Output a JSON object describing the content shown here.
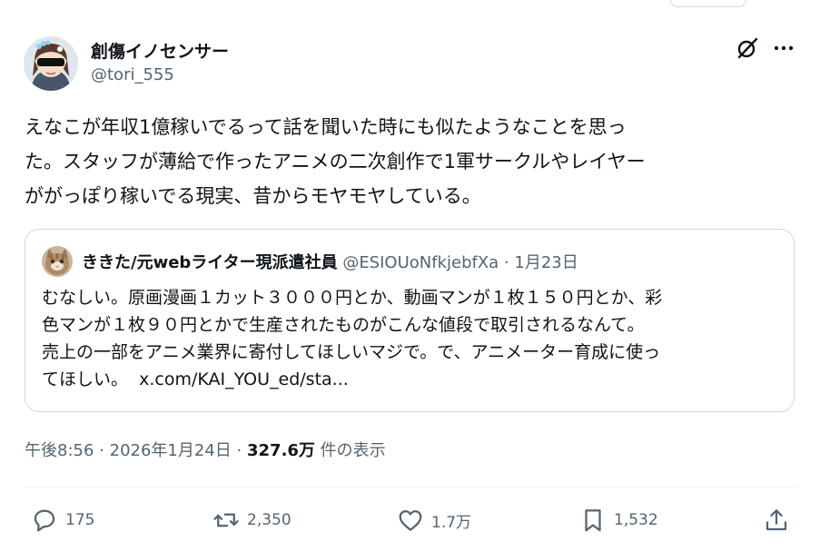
{
  "author": {
    "name": "創傷イノセンサー",
    "handle": "@tori_555"
  },
  "tweet": {
    "lines": [
      "えなこが年収1億稼いでるって話を聞いた時にも似たようなことを思っ",
      "た。スタッフが薄給で作ったアニメの二次創作で1軍サークルやレイヤー",
      "ががっぽり稼いでる現実、昔からモヤモヤしている。"
    ]
  },
  "quote": {
    "name": "ききた/元webライター現派遣社員",
    "handle": "@ESIOUoNfkjebfXa",
    "separator": "·",
    "date": "1月23日",
    "lines": [
      "むなしい。原画漫画１カット３０００円とか、動画マンが１枚１５０円とか、彩",
      "色マンが１枚９０円とかで生産されたものがこんな値段で取引されるなんて。",
      "売上の一部をアニメ業界に寄付してほしいマジで。で、アニメーター育成に使っ",
      "てほしい。"
    ],
    "link": "x.com/KAI_YOU_ed/sta..."
  },
  "meta": {
    "time": "午後8:56",
    "sep1": "·",
    "date": "2026年1月24日",
    "sep2": "·",
    "views": "327.6万",
    "views_label": "件の表示"
  },
  "actions": {
    "replies": "175",
    "reposts": "2,350",
    "likes": "1.7万",
    "bookmarks": "1,532"
  },
  "icons": {
    "reply": "reply-icon",
    "repost": "repost-icon",
    "like": "heart-icon",
    "bookmark": "bookmark-icon",
    "share": "share-icon",
    "grok": "grok-icon",
    "more": "more-icon"
  },
  "colors": {
    "text": "#0f1419",
    "secondary": "#536471",
    "border": "#cfd9de"
  }
}
